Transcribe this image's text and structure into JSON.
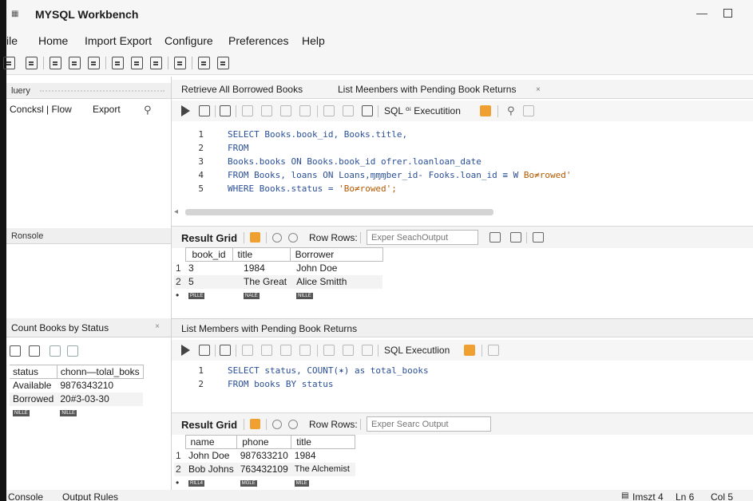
{
  "window": {
    "title": "MYSQL Workbench",
    "app_icon": "app-icon"
  },
  "menu": {
    "items": [
      "ile",
      "Home",
      "Import Export",
      "Configure",
      "Preferences",
      "Help"
    ]
  },
  "left": {
    "query_header": "luery",
    "subtabs": [
      "Concksl | Flow",
      "Export"
    ],
    "console_header": "Ronsole",
    "tab_title": "Count Books by Status",
    "grid": {
      "columns": [
        "status",
        "chonn—tolal_boks"
      ],
      "rows": [
        [
          "Available",
          "9876343210"
        ],
        [
          "Borrowed",
          "20#3-03-30"
        ]
      ],
      "tags": [
        "NILLE",
        "NILLE"
      ]
    }
  },
  "tabs": [
    "Retrieve All Borrowed Books",
    "List Meenbers with Pending Book Returns"
  ],
  "tab_close": "×",
  "editor1": {
    "exec_label": "SQL ⁰ⁱ Executition",
    "lines": [
      {
        "n": "1",
        "code": "SELECT Books.book_id, Books.title,"
      },
      {
        "n": "2",
        "code": "FROM"
      },
      {
        "n": "3",
        "code": "Books.books ON Books.book_id ofrer.loanloan_date"
      },
      {
        "n": "4",
        "code": "FROM Books, loans ON Loans,ɱɱɱber_id- Fooks.loan_id ≡ W ",
        "str": "Bo≠rowed'"
      },
      {
        "n": "5",
        "code": "WHERE Books.status = ",
        "str": "'Bo≠rowed';"
      }
    ]
  },
  "result1": {
    "label": "Result Grid",
    "row_rows": "Row Rows:",
    "filter_placeholder": "Exper SeachOutput",
    "columns": [
      "book_id",
      "title",
      "Borrower"
    ],
    "rows": [
      {
        "n": "1",
        "cells": [
          "3",
          "1984",
          "John Doe"
        ]
      },
      {
        "n": "2",
        "cells": [
          "5",
          "The Great",
          "Alice Smitth"
        ]
      }
    ],
    "tags": [
      "PILLE",
      "NALE",
      "NILLE"
    ]
  },
  "section2_title": "List Members with Pending Book Returns",
  "editor2": {
    "exec_label": "SQL Executlion",
    "lines": [
      {
        "n": "1",
        "code": "SELECT status, COUNT(✶) as total_books"
      },
      {
        "n": "2",
        "code": "FROM books BY status"
      }
    ]
  },
  "result2": {
    "label": "Result Grid",
    "row_rows": "Row Rows:",
    "filter_placeholder": "Exper Searc Output",
    "columns": [
      "name",
      "phone",
      "title"
    ],
    "rows": [
      {
        "n": "1",
        "cells": [
          "John Doe",
          "987633210",
          "1984"
        ]
      },
      {
        "n": "2",
        "cells": [
          "Bob Johns",
          "763432109",
          "The Alchemist"
        ]
      }
    ],
    "tags": [
      "RILL4",
      "MGLE",
      "MILE"
    ]
  },
  "status": {
    "left": [
      "Console",
      "Output Rules"
    ],
    "right": [
      "Imszt 4",
      "Ln 6",
      "Col 5"
    ]
  },
  "colors": {
    "accent": "#4a76c8",
    "keyword": "#2a4f98",
    "string": "#b35a00",
    "warning": "#f0a030"
  }
}
